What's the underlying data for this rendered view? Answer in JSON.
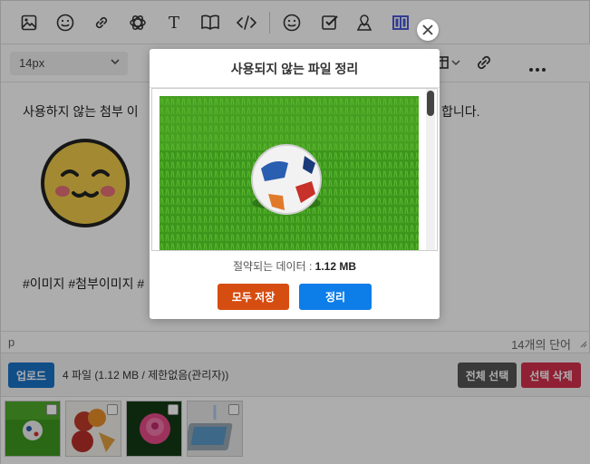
{
  "toolbar": {
    "icons": [
      "image-icon",
      "emoji-icon",
      "link-icon",
      "openai-icon",
      "text-icon",
      "book-icon",
      "code-icon",
      "smiley-icon",
      "checkbox-icon",
      "map-pin-icon",
      "layout-icon"
    ],
    "font_size": "14px"
  },
  "content": {
    "line1_left": "사용하지 않는 첨부 이",
    "line1_right": "합니다.",
    "hashtags": "#이미지 #첨부이미지 #"
  },
  "status": {
    "path": "p",
    "word_count": "14개의 단어"
  },
  "upload": {
    "button": "업로드",
    "info": "4 파일 (1.12 MB / 제한없음(관리자))",
    "select_all": "전체 선택",
    "delete_selected": "선택 삭제"
  },
  "thumbnails": [
    "soccer ball on grass",
    "peaches and fruit",
    "pink rose",
    "tablet with water"
  ],
  "modal": {
    "title": "사용되지 않는 파일 정리",
    "savings_label": "절약되는 데이터 :",
    "savings_value": "1.12 MB",
    "save_all": "모두 저장",
    "clean": "정리"
  },
  "colors": {
    "upload_btn": "#1a73c8",
    "select_all_btn": "#555555",
    "delete_btn": "#d4304d",
    "save_all_btn": "#d64d12",
    "clean_btn": "#0d7de8"
  }
}
